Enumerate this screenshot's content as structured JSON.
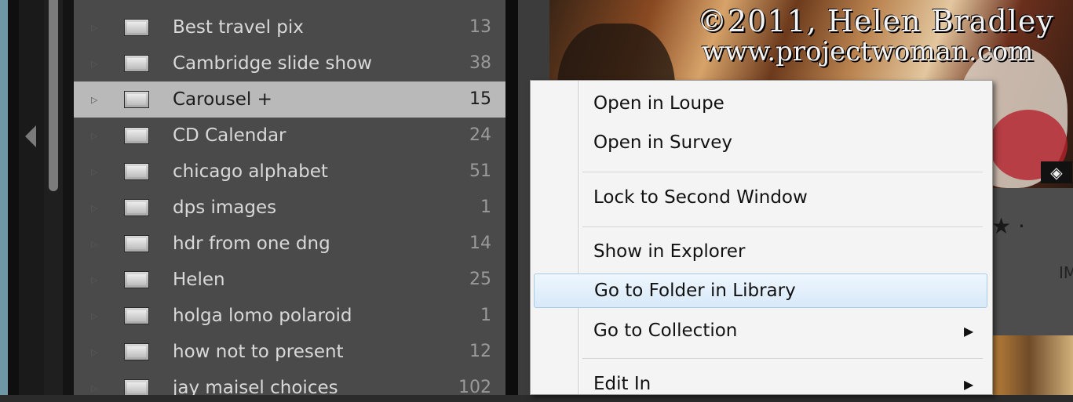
{
  "collections": {
    "items": [
      {
        "name": "Best travel pix",
        "count": "13"
      },
      {
        "name": "Cambridge slide show",
        "count": "38"
      },
      {
        "name": "Carousel  +",
        "count": "15",
        "selected": true
      },
      {
        "name": "CD Calendar",
        "count": "24"
      },
      {
        "name": "chicago alphabet",
        "count": "51"
      },
      {
        "name": "dps images",
        "count": "1"
      },
      {
        "name": "hdr from one dng",
        "count": "14"
      },
      {
        "name": "Helen",
        "count": "25"
      },
      {
        "name": "holga lomo polaroid",
        "count": "1"
      },
      {
        "name": "how not to present",
        "count": "12"
      },
      {
        "name": "jay maisel choices",
        "count": "102"
      }
    ]
  },
  "watermark": {
    "line1": "©2011, Helen Bradley",
    "line2": "www.projectwoman.com"
  },
  "strip": {
    "star": "★ ·",
    "im_label": "IM",
    "tag": "◈"
  },
  "context_menu": {
    "items": [
      {
        "label": "Open in Loupe"
      },
      {
        "label": "Open in Survey"
      },
      {
        "label": "Lock to Second Window"
      },
      {
        "label": "Show in Explorer"
      },
      {
        "label": "Go to Folder in Library",
        "hover": true
      },
      {
        "label": "Go to Collection",
        "submenu": true
      },
      {
        "label": "Edit In",
        "submenu": true
      }
    ],
    "submenu_arrow": "▶"
  },
  "icons": {
    "expander": "▷",
    "collapse": "left-triangle-icon",
    "folder": "collection-folder-icon"
  }
}
